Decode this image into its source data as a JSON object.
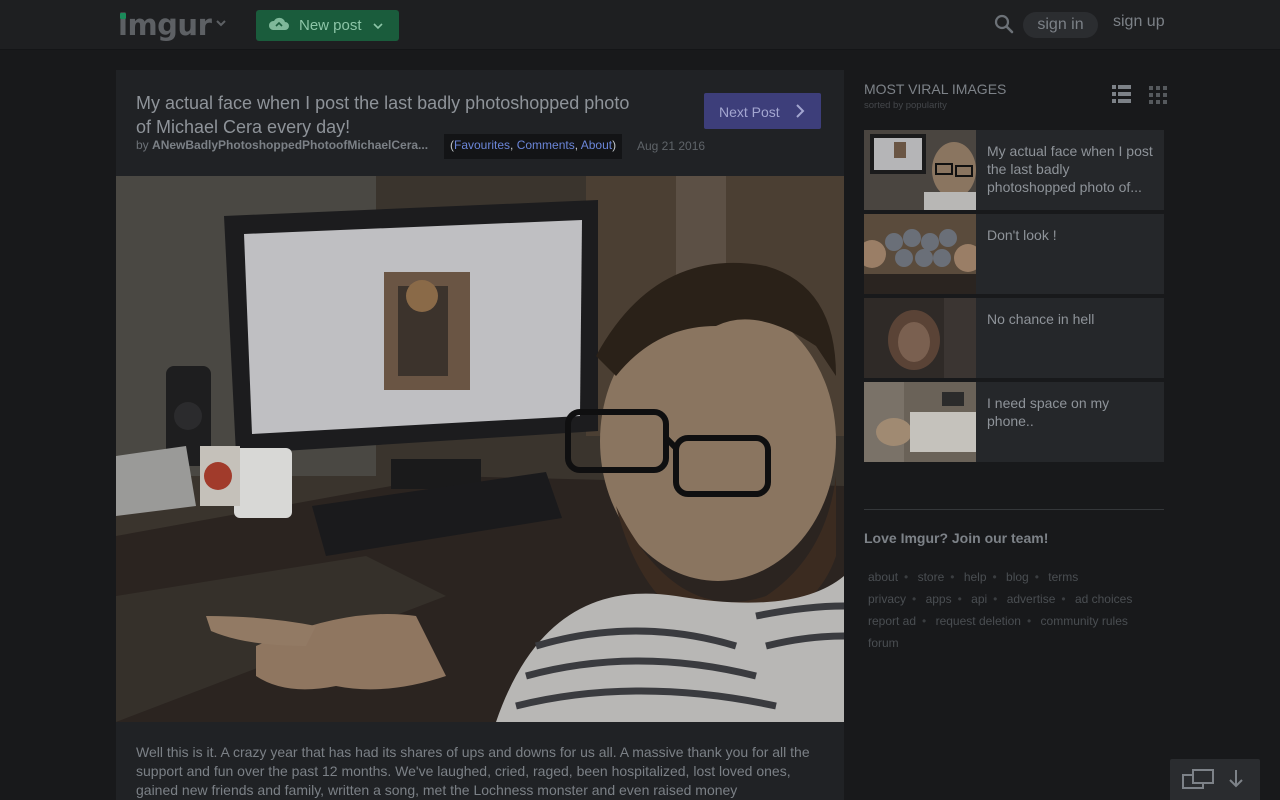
{
  "nav": {
    "logo_text": "imgur",
    "new_post_label": "New post",
    "sign_in_label": "sign in",
    "sign_up_label": "sign up",
    "icons": [
      "imgur-logo",
      "chevron-down-icon",
      "cloud-upload-icon",
      "search-icon"
    ]
  },
  "post": {
    "title": "My actual face when I post the last badly photoshopped photo of Michael Cera every day!",
    "by_label": "by",
    "author": "ANewBadlyPhotoshoppedPhotoofMichaelCera...",
    "links_open": "(",
    "links": [
      "Favourites",
      "Comments",
      "About"
    ],
    "links_sep": ", ",
    "links_close": ")",
    "date": "Aug 21 2016",
    "next_post_label": "Next Post",
    "description": "Well this is it. A crazy year that has had its shares of ups and downs for us all. A massive thank you for all the support and fun over the past 12 months. We've laughed, cried, raged, been hospitalized, lost loved ones, gained new friends and family, written a song, met the Lochness monster and even raised money"
  },
  "sidebar": {
    "heading": "MOST VIRAL IMAGES",
    "subheading": "sorted by popularity",
    "items": [
      {
        "title": "My actual face when I post the last badly photoshopped photo of..."
      },
      {
        "title": "Don't look !"
      },
      {
        "title": "No chance in hell"
      },
      {
        "title": "I need space on my phone.."
      }
    ],
    "join_text": "Love Imgur? Join our team!",
    "footer_links": [
      "about",
      "store",
      "help",
      "blog",
      "terms",
      "privacy",
      "apps",
      "api",
      "advertise",
      "ad choices",
      "report ad",
      "request deletion",
      "community rules",
      "forum"
    ]
  },
  "colors": {
    "page_bg": "#18191b",
    "brand_green": "#1b8a5a",
    "next_post": "#3d3e7a",
    "link_blue": "#6b86d9"
  }
}
